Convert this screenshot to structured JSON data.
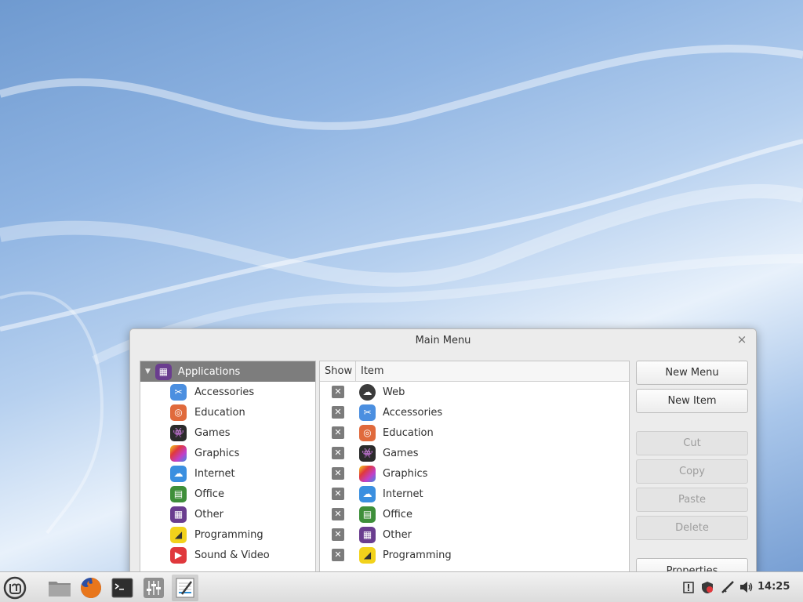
{
  "window": {
    "title": "Main Menu",
    "close_glyph": "×"
  },
  "tree": {
    "root": {
      "label": "Applications",
      "icon": "applications-grid-icon",
      "color": "#6a3d8f"
    },
    "items": [
      {
        "label": "Accessories",
        "icon": "scissors-icon",
        "color": "#4b8fe0"
      },
      {
        "label": "Education",
        "icon": "education-icon",
        "color": "#e06a3c"
      },
      {
        "label": "Games",
        "icon": "gamepad-icon",
        "color": "#2b2b2b"
      },
      {
        "label": "Graphics",
        "icon": "graphics-icon",
        "color": "#c23fc9"
      },
      {
        "label": "Internet",
        "icon": "cloud-icon",
        "color": "#3a8fe0"
      },
      {
        "label": "Office",
        "icon": "office-icon",
        "color": "#3e8f3a"
      },
      {
        "label": "Other",
        "icon": "grid-icon",
        "color": "#6a3d8f"
      },
      {
        "label": "Programming",
        "icon": "programming-icon",
        "color": "#f2d21b"
      },
      {
        "label": "Sound & Video",
        "icon": "play-icon",
        "color": "#e0383c"
      }
    ]
  },
  "list": {
    "headers": {
      "show": "Show",
      "item": "Item"
    },
    "items": [
      {
        "label": "Web",
        "icon": "web-cloud-icon",
        "color": "#3b3b3b",
        "show": "✕"
      },
      {
        "label": "Accessories",
        "icon": "scissors-icon",
        "color": "#4b8fe0",
        "show": "✕"
      },
      {
        "label": "Education",
        "icon": "education-icon",
        "color": "#e06a3c",
        "show": "✕"
      },
      {
        "label": "Games",
        "icon": "gamepad-icon",
        "color": "#2b2b2b",
        "show": "✕"
      },
      {
        "label": "Graphics",
        "icon": "graphics-icon",
        "color": "#c23fc9",
        "show": "✕"
      },
      {
        "label": "Internet",
        "icon": "cloud-icon",
        "color": "#3a8fe0",
        "show": "✕"
      },
      {
        "label": "Office",
        "icon": "office-icon",
        "color": "#3e8f3a",
        "show": "✕"
      },
      {
        "label": "Other",
        "icon": "grid-icon",
        "color": "#6a3d8f",
        "show": "✕"
      },
      {
        "label": "Programming",
        "icon": "programming-icon",
        "color": "#f2d21b",
        "show": "✕"
      }
    ]
  },
  "buttons": {
    "new_menu": "New Menu",
    "new_item": "New Item",
    "cut": "Cut",
    "copy": "Copy",
    "paste": "Paste",
    "delete": "Delete",
    "properties": "Properties"
  },
  "taskbar": {
    "clock": "14:25",
    "launchers": [
      "mint-menu-icon",
      "files-icon",
      "firefox-icon",
      "terminal-icon",
      "mixer-icon",
      "text-editor-icon"
    ],
    "tray": [
      "update-icon",
      "shield-icon",
      "network-icon",
      "volume-icon"
    ]
  }
}
